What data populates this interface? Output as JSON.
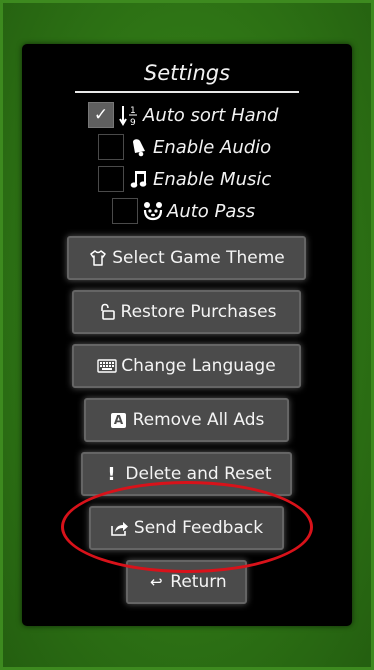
{
  "settings": {
    "title": "Settings",
    "options": [
      {
        "label": "Auto sort Hand",
        "checked": true,
        "icon": "sort-numeric-icon"
      },
      {
        "label": "Enable Audio",
        "checked": false,
        "icon": "bell-icon"
      },
      {
        "label": "Enable Music",
        "checked": false,
        "icon": "music-note-icon"
      },
      {
        "label": "Auto Pass",
        "checked": false,
        "icon": "panda-face-icon"
      }
    ],
    "check_mark": "✓",
    "sort_digits": {
      "top": "1",
      "bottom": "9"
    },
    "buttons": [
      {
        "label": "Select Game Theme",
        "icon": "shirt-icon"
      },
      {
        "label": "Restore Purchases",
        "icon": "unlock-icon"
      },
      {
        "label": "Change Language",
        "icon": "keyboard-icon"
      },
      {
        "label": "Remove All Ads",
        "icon": "ad-block-icon",
        "icon_glyph": "A"
      },
      {
        "label": "Delete and Reset",
        "icon": "exclamation-icon",
        "icon_glyph": "!"
      },
      {
        "label": "Send Feedback",
        "icon": "share-icon"
      },
      {
        "label": "Return",
        "icon": "return-arrow-icon",
        "icon_glyph": "↩"
      }
    ]
  },
  "colors": {
    "background": "#2f7516",
    "panel": "#000000",
    "button": "#4b4b4b",
    "highlight_circle": "#d8121a"
  }
}
